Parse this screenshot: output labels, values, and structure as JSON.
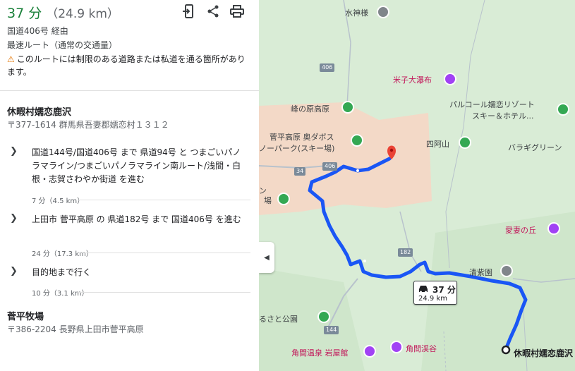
{
  "summary": {
    "time": "37 分",
    "distance": "（24.9 km）",
    "via": "国道406号 経由",
    "fastest": "最速ルート（通常の交通量）",
    "warning": "このルートには制限のある道路または私道を通る箇所があります。"
  },
  "icons": [
    "send-to-phone-icon",
    "share-icon",
    "print-icon"
  ],
  "origin": {
    "name": "休暇村嬬恋鹿沢",
    "address": "〒377-1614 群馬県吾妻郡嬬恋村１３１２"
  },
  "steps": [
    {
      "text": "国道144号/国道406号 まで 県道94号 と つまごいパノラマライン/つまごいパノラマライン南ルート/浅間・白根・志賀さわやか街道 を進む",
      "detail": "7 分（4.5 km）"
    },
    {
      "text": "上田市 菅平高原 の 県道182号 まで 国道406号 を進む",
      "detail": "24 分（17.3 km）"
    },
    {
      "text": "目的地まで行く",
      "detail": "10 分（3.1 km）"
    }
  ],
  "destination": {
    "name": "菅平牧場",
    "address": "〒386-2204 長野県上田市菅平高原"
  },
  "map": {
    "labels": {
      "suijinsama": "水神様",
      "yonako": "米子大瀑布",
      "minenohara": "峰の原高原",
      "sugadaira": "菅平高原 奥ダボス",
      "sugadaira2": "ノーパーク(スキー場)",
      "shiaizan": "四阿山",
      "palcall": "パルコール嬬恋リゾート",
      "palcall2": "スキー＆ホテル...",
      "baragi": "バラギグリーン",
      "aizuma": "愛妻の丘",
      "seishien": "清紫園",
      "furusato": "るさと公園",
      "kakuma": "角間温泉 岩屋館",
      "kakumakei": "角間渓谷",
      "ba": "場",
      "n": "ン"
    },
    "roads": [
      "406",
      "34",
      "406",
      "182",
      "144"
    ],
    "chip_time": "37 分",
    "chip_dist": "24.9 km",
    "dest_label": "休暇村嬬恋鹿沢"
  },
  "colors": {
    "accent_green": "#188038",
    "route_blue": "#1a56f5",
    "map_green": "#d9ecd6",
    "town": "#f3d9c7"
  }
}
